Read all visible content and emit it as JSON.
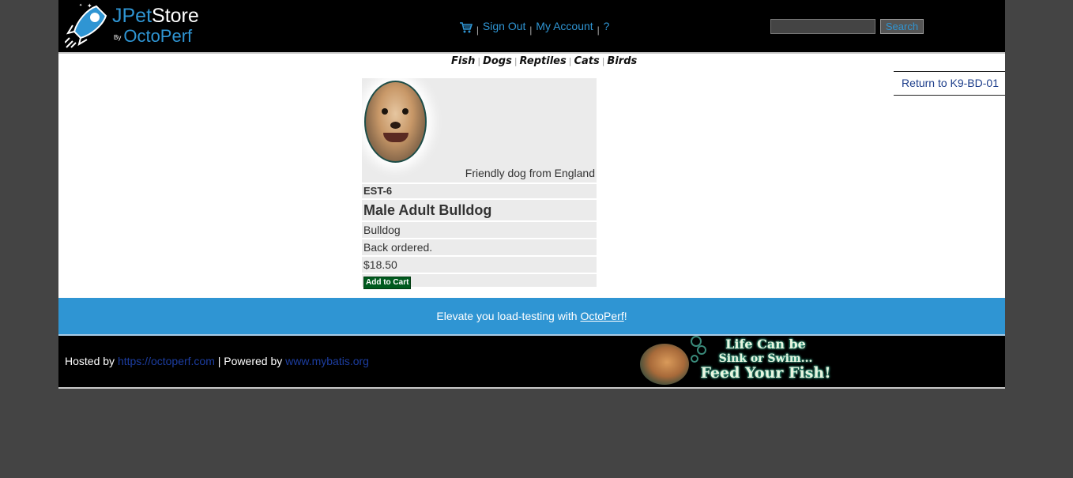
{
  "header": {
    "logo": {
      "brand_part1": "JPet",
      "brand_part2": "Store",
      "by": "By",
      "brand_company": "OctoPerf"
    },
    "menu": {
      "cart_icon": "cart-icon",
      "sign_out": "Sign Out",
      "my_account": "My Account",
      "help": "?"
    },
    "search": {
      "value": "",
      "button": "Search"
    }
  },
  "quicklinks": [
    "Fish",
    "Dogs",
    "Reptiles",
    "Cats",
    "Birds"
  ],
  "back_link": "Return to K9-BD-01",
  "item": {
    "description": "Friendly dog from England",
    "id": "EST-6",
    "name": "Male Adult Bulldog",
    "product": "Bulldog",
    "stock": "Back ordered.",
    "price": "$18.50",
    "add_to_cart": "Add to Cart"
  },
  "promo": {
    "text_before": "Elevate you load-testing with ",
    "link": "OctoPerf",
    "text_after": "!"
  },
  "footer": {
    "hosted_by": "Hosted by ",
    "hosted_link": "https://octoperf.com",
    "powered_by": " | Powered by ",
    "powered_link": "www.mybatis.org",
    "banner": {
      "line1": "Life Can be",
      "line2": "Sink or Swim...",
      "line3": "Feed Your Fish!"
    }
  },
  "colors": {
    "accent": "#2f95d3",
    "header_bg": "#000000",
    "page_bg": "#444444",
    "cart_button": "#005a1e"
  }
}
